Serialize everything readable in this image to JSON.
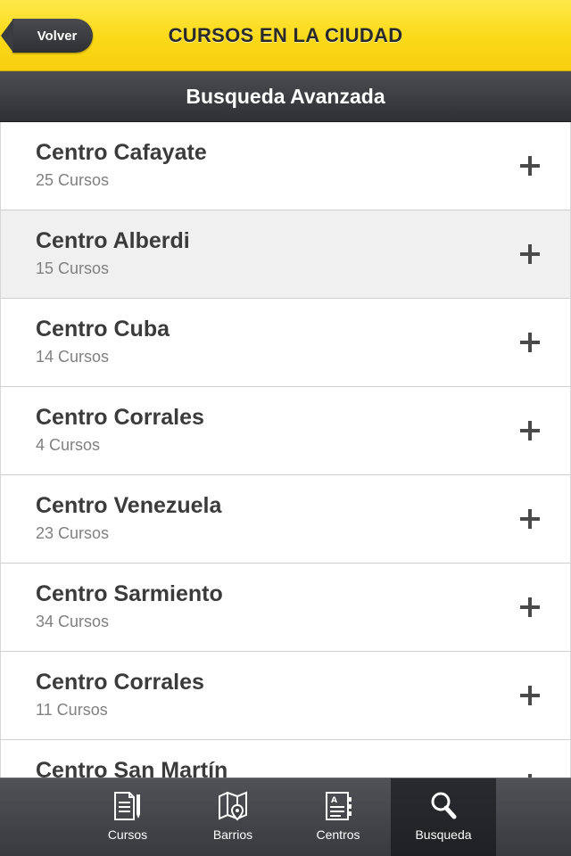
{
  "header": {
    "back_label": "Volver",
    "title": "CURSOS EN LA CIUDAD"
  },
  "subheader": {
    "title": "Busqueda Avanzada"
  },
  "list": {
    "items": [
      {
        "name": "Centro Cafayate",
        "count": "25 Cursos"
      },
      {
        "name": "Centro Alberdi",
        "count": "15 Cursos"
      },
      {
        "name": "Centro Cuba",
        "count": "14 Cursos"
      },
      {
        "name": "Centro Corrales",
        "count": "4 Cursos"
      },
      {
        "name": "Centro Venezuela",
        "count": "23 Cursos"
      },
      {
        "name": "Centro Sarmiento",
        "count": "34 Cursos"
      },
      {
        "name": "Centro Corrales",
        "count": "11 Cursos"
      },
      {
        "name": "Centro San Martín",
        "count": ""
      }
    ]
  },
  "tabs": [
    {
      "label": "Cursos",
      "icon": "document-pencil-icon"
    },
    {
      "label": "Barrios",
      "icon": "map-pin-icon"
    },
    {
      "label": "Centros",
      "icon": "address-book-icon"
    },
    {
      "label": "Busqueda",
      "icon": "search-icon"
    }
  ],
  "colors": {
    "header_yellow": "#fbd916",
    "dark_bar": "#3b3c40",
    "row_highlight": "#f0f0f0"
  }
}
